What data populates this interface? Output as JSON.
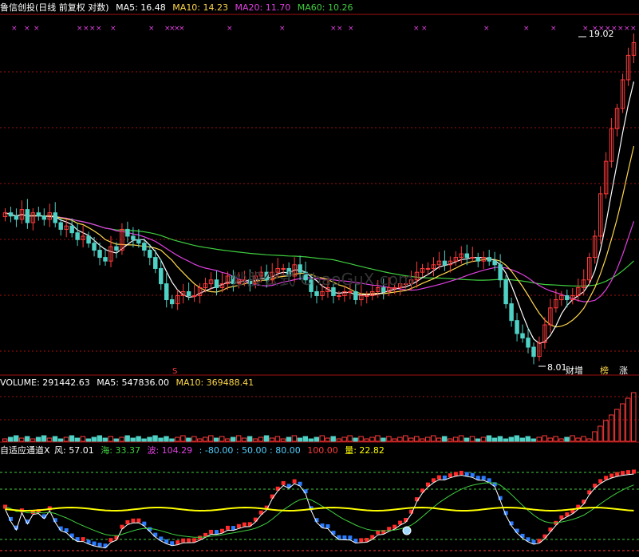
{
  "colors": {
    "up": "#ff3b3b",
    "down": "#4fd1c5",
    "ma5": "#ffffff",
    "ma10": "#ffd84a",
    "ma20": "#e040e0",
    "ma60": "#3fcf3f",
    "channel_up": "#ff2a2a",
    "channel_down": "#2a7bff",
    "level_line": "#ffff00",
    "grid": "#a01010",
    "sea": "#3fcf3f",
    "wave": "#e040e0",
    "level": "#4fd1ff",
    "vol_text": "#ffff00"
  },
  "price_panel": {
    "title": "鲁信创投(日线 前复权 对数)",
    "ma5_label": "MA5: 16.48",
    "ma10_label": "MA10: 14.23",
    "ma20_label": "MA20: 11.70",
    "ma60_label": "MA60: 10.26",
    "high_label": "19.02",
    "low_label": "8.01",
    "markers": [
      "财",
      "增",
      "榜",
      "涨"
    ],
    "s_marker": "S",
    "watermark": "炒股公式 ChaoGuX.com"
  },
  "volume_panel": {
    "volume_label": "VOLUME: 291442.63",
    "ma5_label": "MA5: 547836.00",
    "ma10_label": "MA10: 369488.41"
  },
  "indicator_panel": {
    "title": "自适应通道X",
    "wind_label": "风: 57.01",
    "sea_label": "海: 33.37",
    "wave_label": "波: 104.29",
    "levels_label": ": -80.00 : 50.00 : 80.00",
    "level_100": "100.00",
    "amount_label": "量: 22.82"
  },
  "chart_data": {
    "type": "candlestick",
    "scale": "log",
    "high": 19.02,
    "low": 8.01,
    "closes": [
      11.9,
      11.8,
      11.7,
      12.0,
      11.6,
      11.9,
      11.8,
      11.7,
      11.9,
      11.6,
      11.4,
      11.5,
      11.3,
      11.1,
      11.2,
      11.0,
      10.8,
      10.6,
      10.5,
      10.9,
      10.8,
      11.4,
      11.2,
      11.1,
      11.0,
      10.8,
      10.6,
      10.3,
      9.9,
      9.5,
      9.4,
      9.6,
      9.7,
      9.6,
      9.6,
      9.8,
      9.9,
      10.0,
      9.8,
      9.9,
      10.1,
      9.9,
      10.0,
      10.0,
      9.9,
      10.1,
      10.2,
      10.0,
      10.2,
      10.3,
      10.3,
      10.1,
      10.4,
      10.2,
      10.0,
      9.7,
      9.6,
      9.7,
      9.8,
      9.6,
      9.6,
      9.7,
      9.7,
      9.5,
      9.6,
      9.6,
      9.7,
      9.8,
      9.7,
      9.8,
      9.8,
      9.9,
      9.9,
      10.0,
      10.2,
      10.3,
      10.3,
      10.4,
      10.5,
      10.4,
      10.5,
      10.6,
      10.7,
      10.6,
      10.6,
      10.5,
      10.6,
      10.5,
      10.4,
      10.0,
      9.4,
      9.0,
      8.7,
      8.6,
      8.4,
      8.2,
      8.5,
      8.9,
      9.3,
      9.5,
      9.6,
      9.5,
      9.6,
      9.8,
      10.0,
      10.6,
      11.2,
      12.5,
      13.6,
      14.8,
      15.6,
      16.8,
      17.9,
      18.5
    ],
    "volume_ma5": 547836.0,
    "volume_ma10": 369488.41,
    "volume_last": 291442.63,
    "indicator": {
      "wind": 57.01,
      "sea": 33.37,
      "wave": 104.29,
      "levels": [
        -80,
        50,
        80,
        100
      ],
      "amount": 22.82
    }
  }
}
